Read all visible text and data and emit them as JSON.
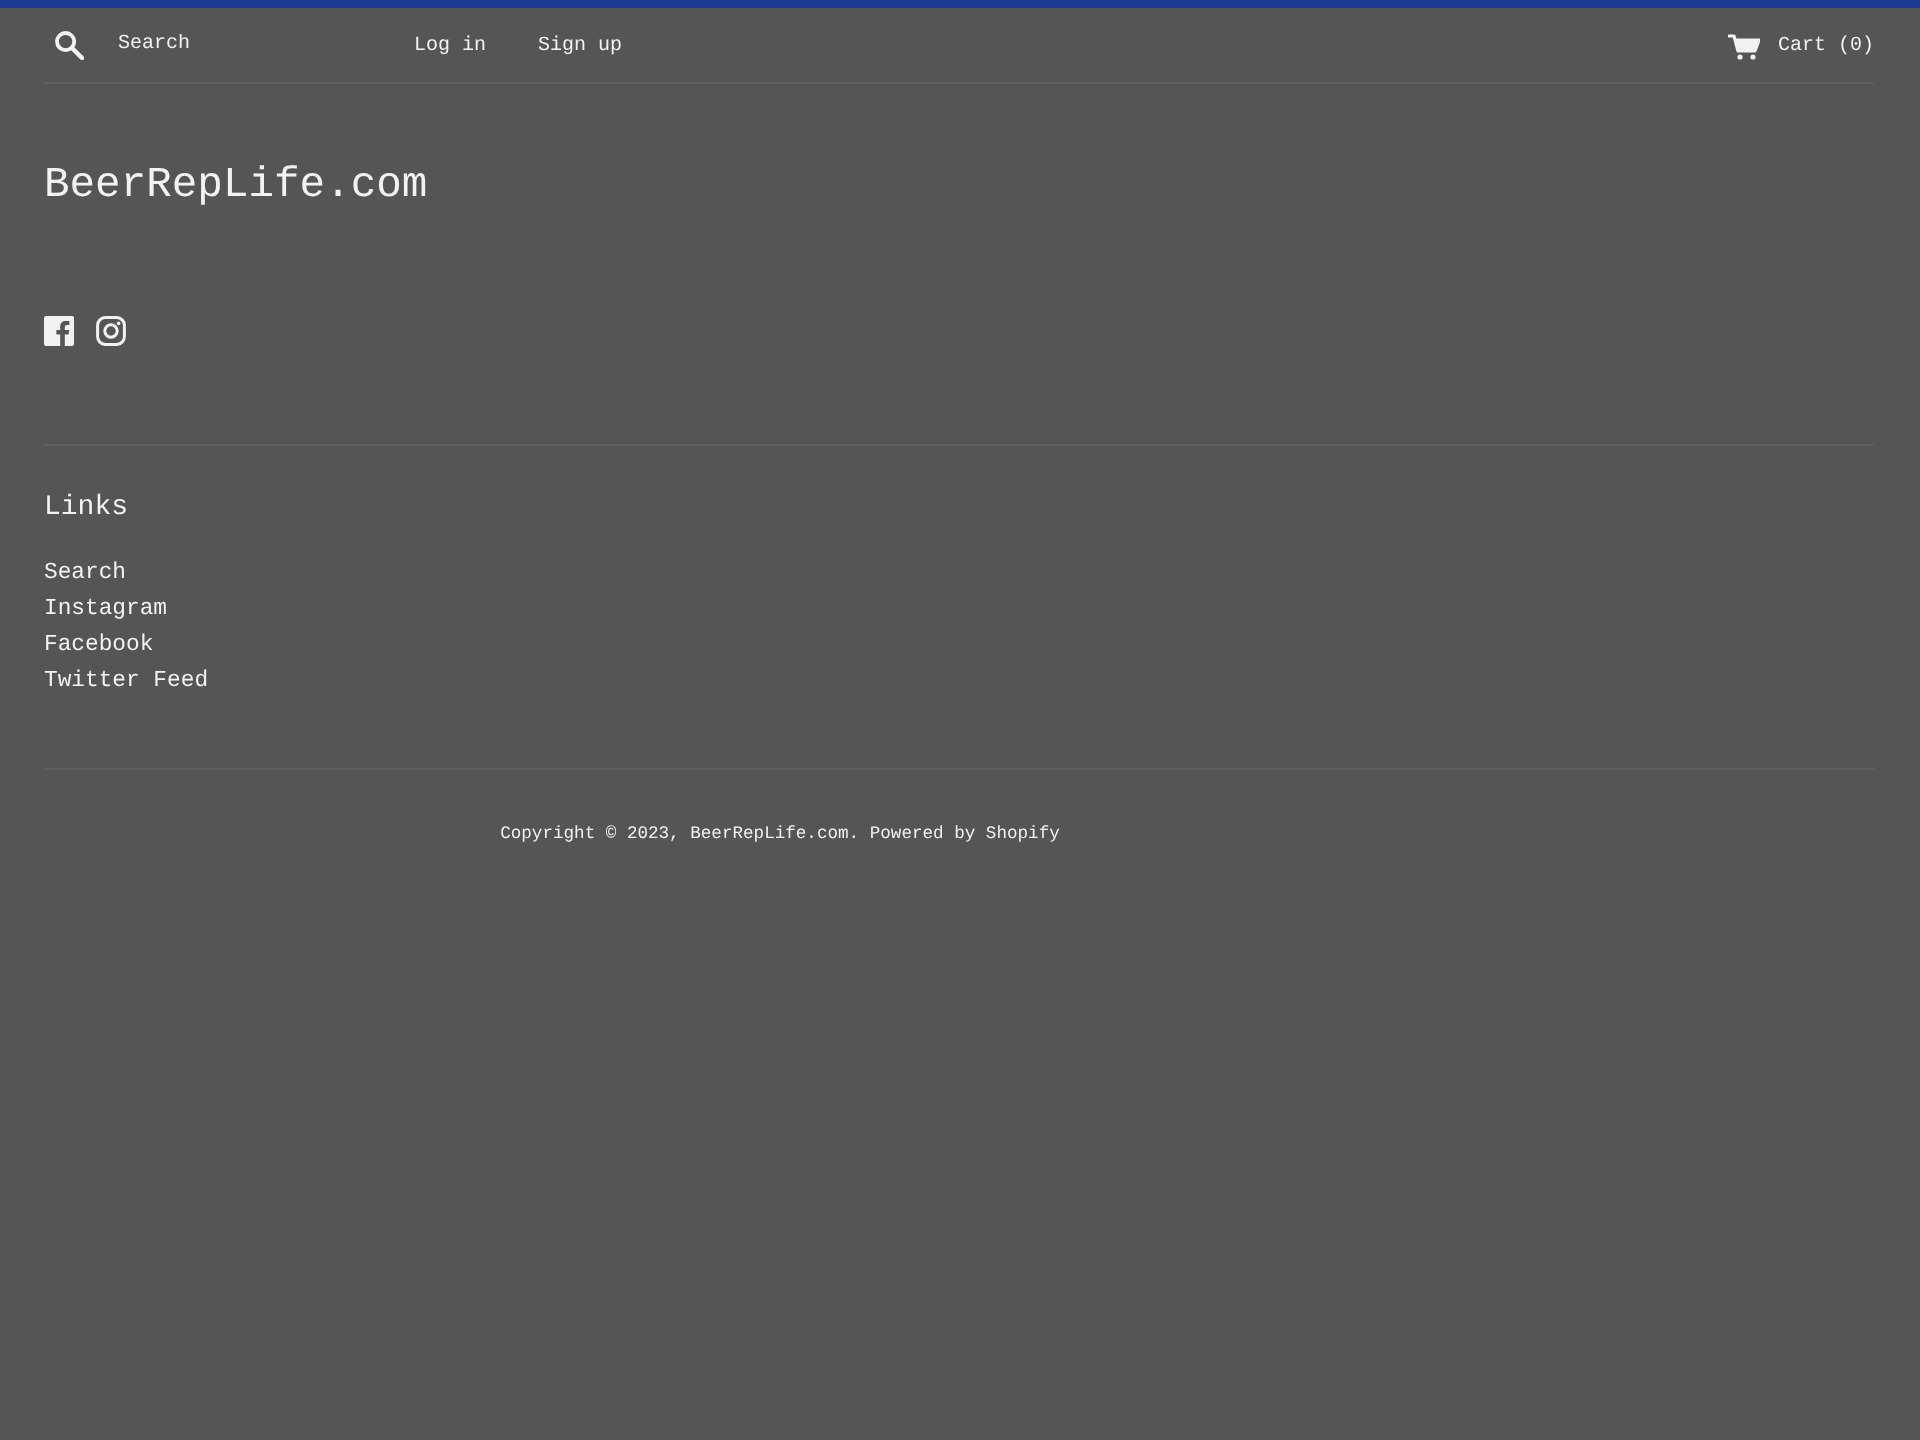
{
  "header": {
    "search": {
      "placeholder": "Search"
    },
    "account_links": [
      "Log in",
      "Sign up"
    ],
    "cart": {
      "label": "Cart (0)"
    }
  },
  "site_title": "BeerRepLife.com",
  "footer": {
    "heading": "Links",
    "links": [
      "Search",
      "Instagram",
      "Facebook",
      "Twitter Feed"
    ],
    "copyright": "Copyright © 2023, BeerRepLife.com. Powered by Shopify"
  }
}
